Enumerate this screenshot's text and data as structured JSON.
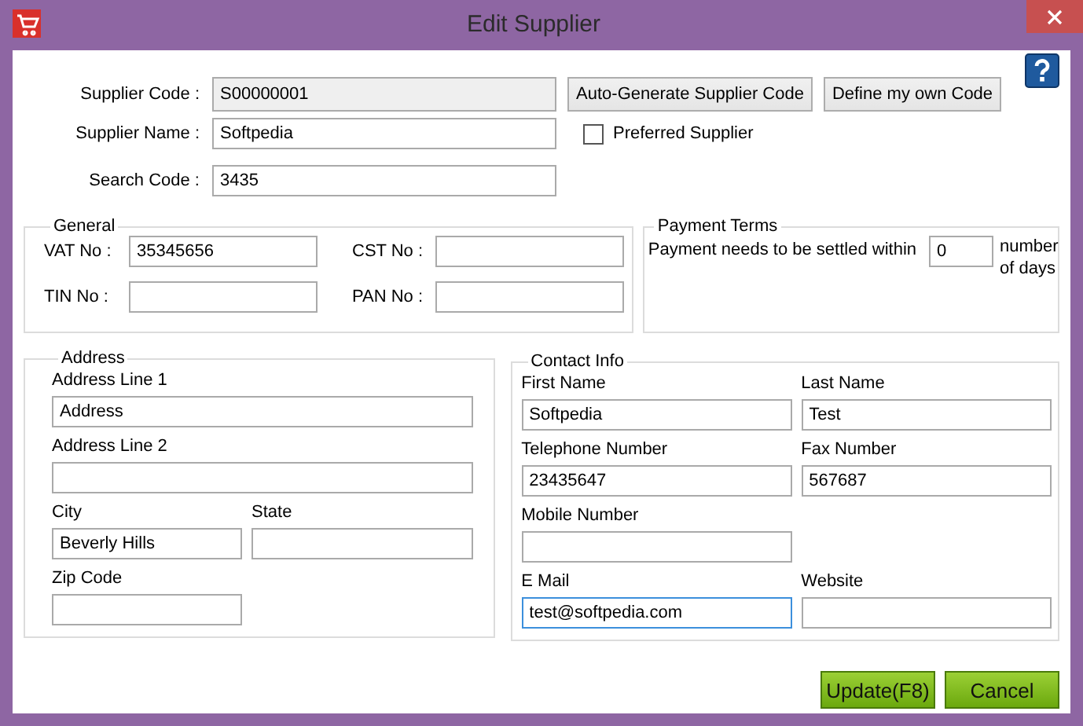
{
  "window": {
    "title": "Edit Supplier"
  },
  "supplier": {
    "code": {
      "label": "Supplier Code :",
      "value": "S00000001",
      "readonly": true
    },
    "code_buttons": [
      "Auto-Generate Supplier Code",
      "Define my own Code"
    ],
    "name": {
      "label": "Supplier Name :",
      "value": "Softpedia",
      "readonly": false
    },
    "preferred": {
      "label": "Preferred Supplier",
      "checked": false
    },
    "search_code": {
      "label": "Search Code :",
      "value": "3435",
      "readonly": false
    }
  },
  "general": {
    "title": "General",
    "rows": [
      [
        {
          "label": "VAT No :",
          "value": "35345656"
        },
        {
          "label": "CST No :"
        }
      ],
      [
        {
          "label": "TIN No :"
        },
        {
          "label": "PAN No :"
        }
      ]
    ]
  },
  "payment_terms": {
    "title": "Payment Terms",
    "text": "Payment needs to be settled within",
    "value": "0",
    "suffix": "number of days"
  },
  "address": {
    "title": "Address",
    "rows": [
      [
        {
          "label": "Address Line 1",
          "value": "Address",
          "wide": true,
          "focused": false
        }
      ],
      [
        {
          "label": "Address Line 2",
          "wide": true,
          "focused": false
        }
      ],
      [
        {
          "label": "City",
          "value": "Beverly Hills",
          "wide": false,
          "focused": false
        },
        {
          "label": "State",
          "wide": false,
          "focused": false
        }
      ],
      [
        {
          "label": "Zip Code",
          "wide": false,
          "focused": false
        }
      ]
    ]
  },
  "contact": {
    "title": "Contact Info",
    "rows": [
      [
        {
          "label": "First Name",
          "value": "Softpedia",
          "wide": false,
          "focused": false
        },
        {
          "label": "Last Name",
          "value": "Test",
          "wide": false,
          "focused": false
        }
      ],
      [
        {
          "label": "Telephone Number",
          "value": "23435647",
          "wide": false,
          "focused": false
        },
        {
          "label": "Fax Number",
          "value": "567687",
          "wide": false,
          "focused": false
        }
      ],
      [
        {
          "label": "Mobile Number",
          "wide": false,
          "focused": false
        }
      ],
      [
        {
          "label": "E Mail",
          "value": "test@softpedia.com",
          "wide": false,
          "focused": true
        },
        {
          "label": "Website",
          "wide": false,
          "focused": false
        }
      ]
    ]
  },
  "buttons": [
    "Update(F8)",
    "Cancel"
  ]
}
